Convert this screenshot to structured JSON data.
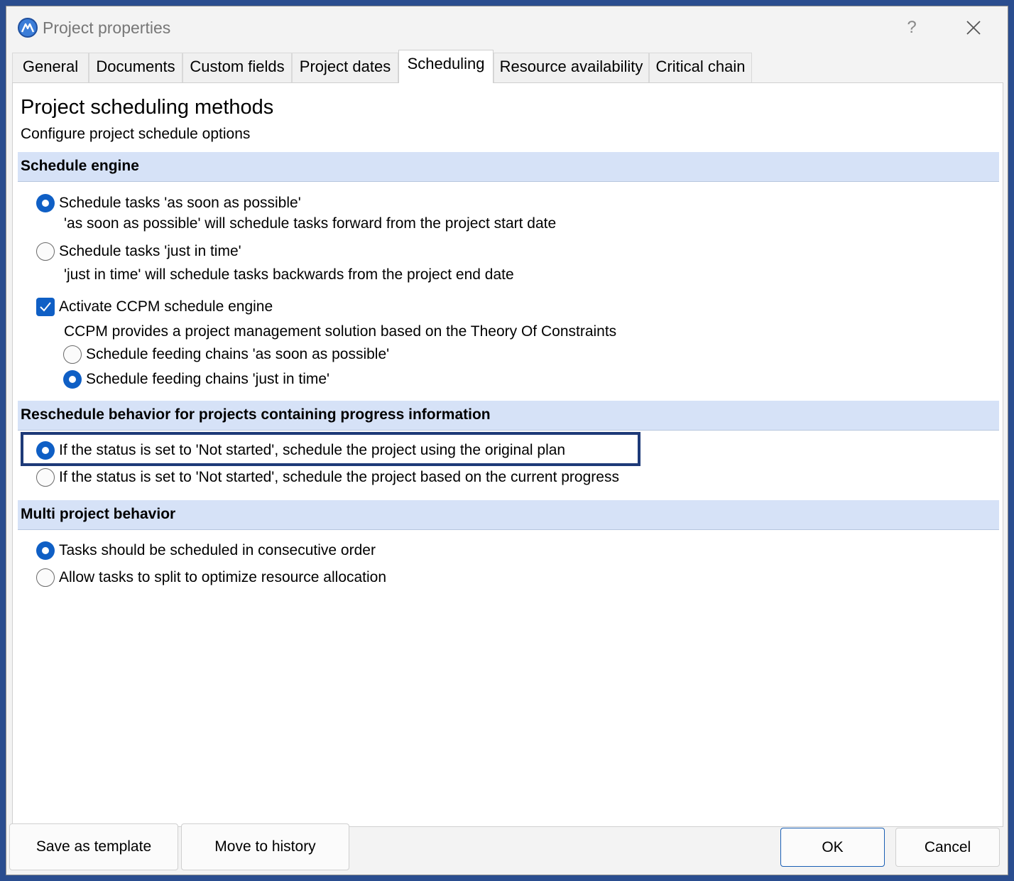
{
  "window": {
    "title": "Project properties",
    "help_label": "?"
  },
  "tabs": [
    {
      "label": "General"
    },
    {
      "label": "Documents"
    },
    {
      "label": "Custom fields"
    },
    {
      "label": "Project dates"
    },
    {
      "label": "Scheduling"
    },
    {
      "label": "Resource availability"
    },
    {
      "label": "Critical chain"
    }
  ],
  "active_tab": "Scheduling",
  "page": {
    "title": "Project scheduling methods",
    "subtitle": "Configure project schedule options"
  },
  "schedule_engine": {
    "header": "Schedule engine",
    "asap_label": "Schedule tasks 'as soon as possible'",
    "asap_desc": "'as soon as possible' will schedule tasks forward from the project start date",
    "jit_label": "Schedule tasks 'just in time'",
    "jit_desc": "'just in time' will schedule tasks backwards from the project end date",
    "ccpm_label": "Activate CCPM schedule engine",
    "ccpm_desc": "CCPM provides a project management solution based on the Theory Of Constraints",
    "feeding_asap_label": "Schedule feeding chains 'as soon as possible'",
    "feeding_jit_label": "Schedule feeding chains 'just in time'"
  },
  "reschedule": {
    "header": "Reschedule behavior for projects containing progress information",
    "original_plan_label": "If the status is set to 'Not started', schedule the project using the original plan",
    "current_progress_label": "If the status is set to 'Not started', schedule the project based on the current progress"
  },
  "multi_project": {
    "header": "Multi project behavior",
    "consecutive_label": "Tasks should be scheduled in consecutive order",
    "split_label": "Allow tasks to split to optimize resource allocation"
  },
  "footer": {
    "save_template_label": "Save as template",
    "move_history_label": "Move to history",
    "ok_label": "OK",
    "cancel_label": "Cancel"
  }
}
